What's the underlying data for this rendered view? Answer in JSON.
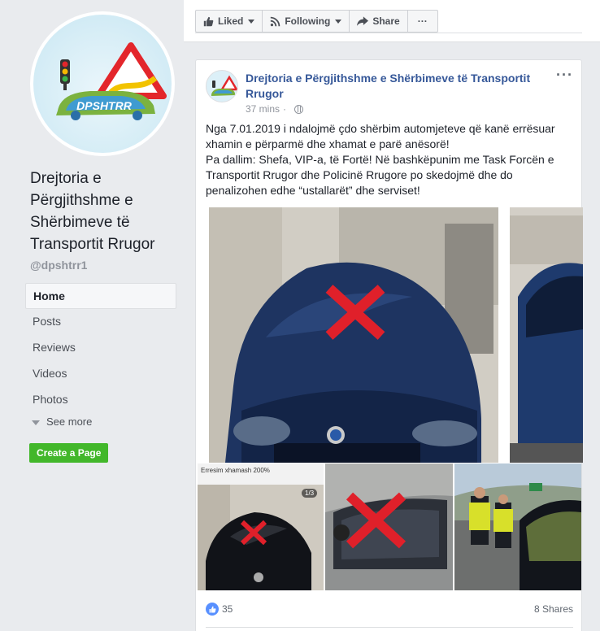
{
  "page": {
    "name": "Drejtoria e Përgjithshme e Shërbimeve të Transportit Rrugor",
    "handle": "@dpshtrr1",
    "logo_text": "DPSHTRR"
  },
  "sidebar": {
    "items": [
      {
        "label": "Home",
        "active": true
      },
      {
        "label": "Posts"
      },
      {
        "label": "Reviews"
      },
      {
        "label": "Videos"
      },
      {
        "label": "Photos"
      }
    ],
    "see_more": "See more",
    "create_page": "Create a Page"
  },
  "toolbar": {
    "liked": "Liked",
    "following": "Following",
    "share": "Share",
    "more": "···"
  },
  "post": {
    "author": "Drejtoria e Përgjithshme e Shërbimeve të Transportit Rrugor",
    "time": "37 mins",
    "separator": "·",
    "text_line1": "Nga 7.01.2019 i ndalojmë çdo shërbim automjeteve që kanë errësuar xhamin e përparmë dhe xhamat e parë anësorë!",
    "text_line2": "Pa dallim: Shefa, VIP-a, të Fortë! Në bashkëpunim me Task Forcën e Transportit Rrugor dhe Policinë Rrugore po skedojmë dhe do penalizohen edhe “ustallarët” dhe serviset!",
    "photo_caption": "Erresim xhamash 200%",
    "photo_badge": "1/3",
    "likes": "35",
    "shares": "8 Shares"
  },
  "colors": {
    "brand_blue": "#365899",
    "like_blue": "#5890ff",
    "create_green": "#42b72a",
    "x_red": "#e0202a"
  }
}
